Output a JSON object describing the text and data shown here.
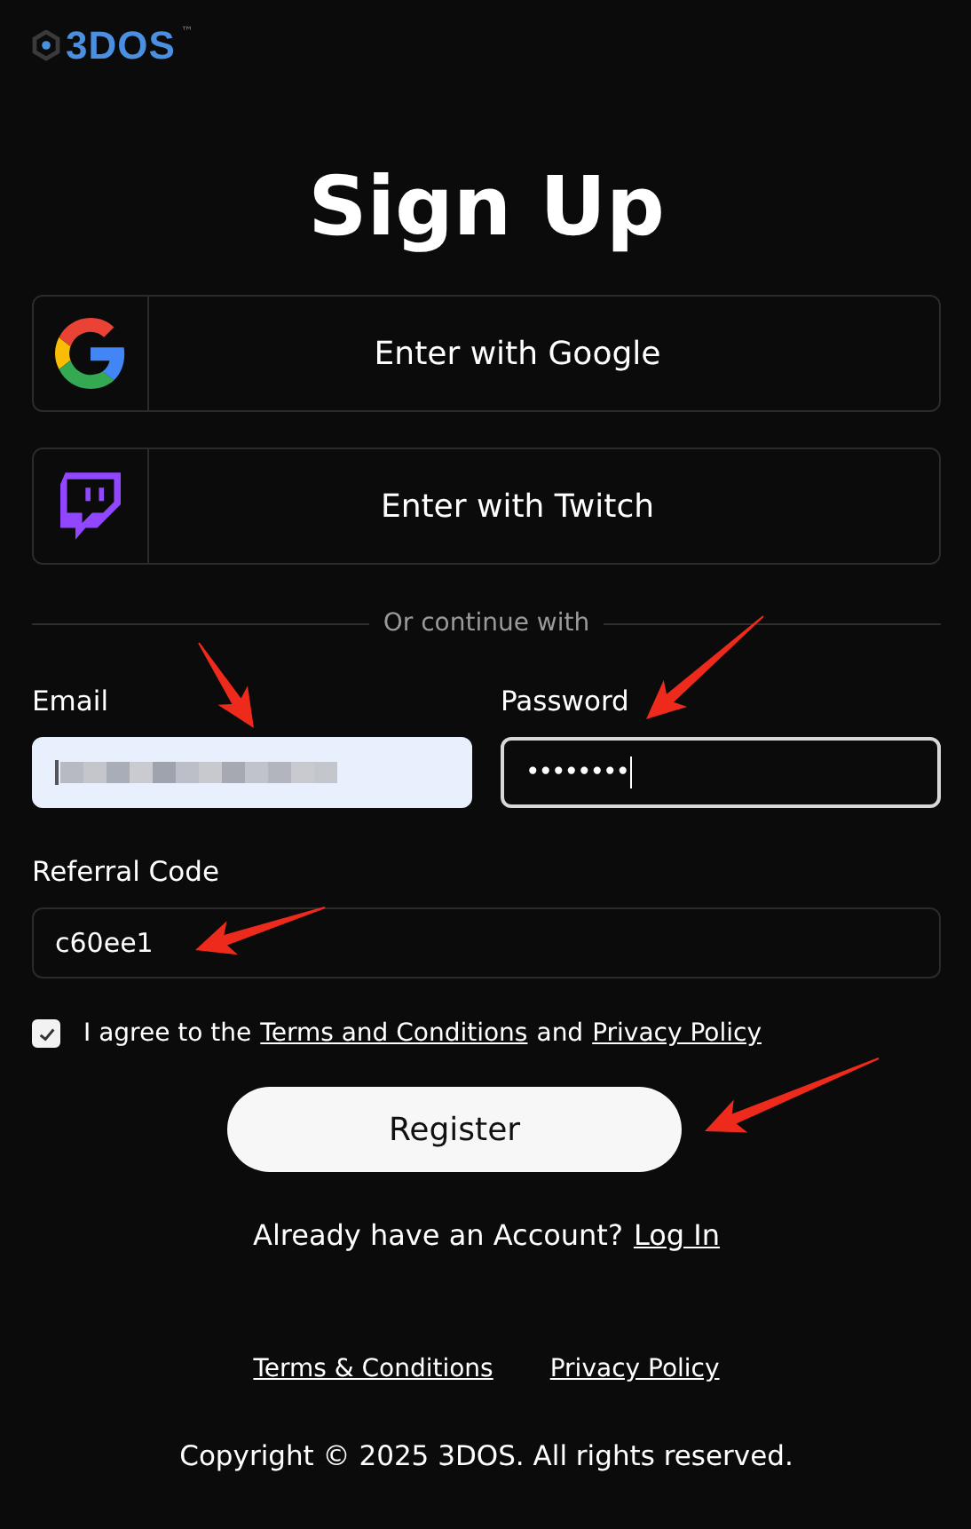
{
  "logo": {
    "text": "3DOS",
    "trademark": "™"
  },
  "title": "Sign Up",
  "social_buttons": [
    {
      "kind": "google",
      "label": "Enter with Google"
    },
    {
      "kind": "twitch",
      "label": "Enter with Twitch"
    }
  ],
  "divider": "Or continue with",
  "fields": [
    {
      "label": "Email",
      "kind": "blurred",
      "focused": false
    },
    {
      "label": "Password",
      "kind": "password",
      "value": "••••••••",
      "focused": true
    }
  ],
  "referral": {
    "label": "Referral Code",
    "value": "c60ee1"
  },
  "agreement": {
    "checked": true,
    "text": "I agree to the",
    "terms_link": "Terms and Conditions",
    "and": "and",
    "privacy_link": "Privacy Policy"
  },
  "register_button": "Register",
  "login_prompt": {
    "text": "Already have an Account?",
    "link": "Log In"
  },
  "footer_links": [
    "Terms & Conditions",
    "Privacy Policy"
  ],
  "copyright": "Copyright © 2025 3DOS. All rights reserved."
}
